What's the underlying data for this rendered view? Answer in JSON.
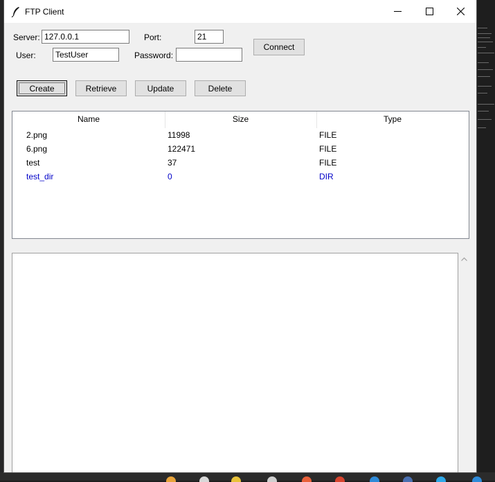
{
  "window": {
    "title": "FTP Client",
    "icon": "feather-icon"
  },
  "controls": {
    "minimize": "minimize-icon",
    "maximize": "maximize-icon",
    "close": "close-icon"
  },
  "form": {
    "server_label": "Server:",
    "server_value": "127.0.0.1",
    "port_label": "Port:",
    "port_value": "21",
    "user_label": "User:",
    "user_value": "TestUser",
    "password_label": "Password:",
    "password_value": "",
    "connect_label": "Connect"
  },
  "actions": {
    "create": "Create",
    "retrieve": "Retrieve",
    "update": "Update",
    "delete": "Delete"
  },
  "files": {
    "columns": [
      "Name",
      "Size",
      "Type"
    ],
    "rows": [
      {
        "name": "2.png",
        "size": "11998",
        "type": "FILE"
      },
      {
        "name": "6.png",
        "size": "122471",
        "type": "FILE"
      },
      {
        "name": "test",
        "size": "37",
        "type": "FILE"
      },
      {
        "name": "test_dir",
        "size": "0",
        "type": "DIR"
      }
    ]
  },
  "colors": {
    "dir_text": "#0000c8",
    "window_bg": "#f0f0f0"
  },
  "log": {
    "text": ""
  }
}
